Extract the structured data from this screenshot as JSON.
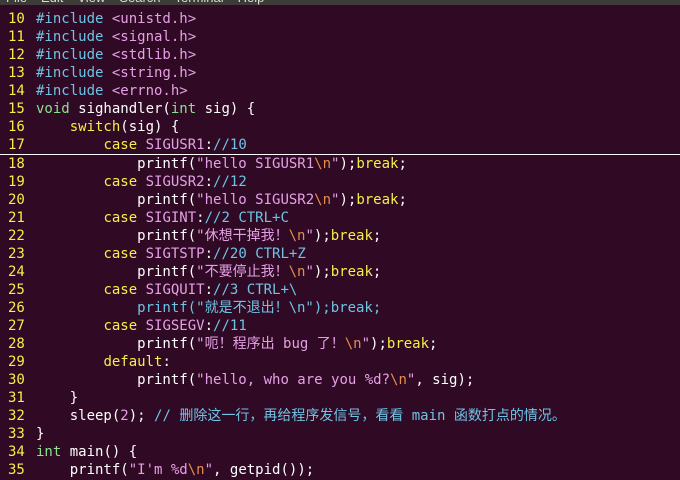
{
  "menu": [
    "File",
    "Edit",
    "View",
    "Search",
    "Terminal",
    "Help"
  ],
  "lines": [
    {
      "n": "10",
      "segs": [
        [
          "pp",
          "#include "
        ],
        [
          "inc",
          "<unistd.h>"
        ]
      ]
    },
    {
      "n": "11",
      "segs": [
        [
          "pp",
          "#include "
        ],
        [
          "inc",
          "<signal.h>"
        ]
      ]
    },
    {
      "n": "12",
      "segs": [
        [
          "pp",
          "#include "
        ],
        [
          "inc",
          "<stdlib.h>"
        ]
      ]
    },
    {
      "n": "13",
      "segs": [
        [
          "pp",
          "#include "
        ],
        [
          "inc",
          "<string.h>"
        ]
      ]
    },
    {
      "n": "14",
      "segs": [
        [
          "pp",
          "#include "
        ],
        [
          "inc",
          "<errno.h>"
        ]
      ]
    },
    {
      "n": "15",
      "segs": [
        [
          "ty",
          "void"
        ],
        [
          "id",
          " sighandler("
        ],
        [
          "ty",
          "int"
        ],
        [
          "id",
          " sig) {"
        ]
      ]
    },
    {
      "n": "16",
      "segs": [
        [
          "id",
          "    "
        ],
        [
          "kw",
          "switch"
        ],
        [
          "id",
          "(sig) {"
        ]
      ]
    },
    {
      "n": "17",
      "cursor": true,
      "segs": [
        [
          "id",
          "        "
        ],
        [
          "kw",
          "case"
        ],
        [
          "id",
          " "
        ],
        [
          "cn",
          "SIGUSR1"
        ],
        [
          "id",
          ":"
        ],
        [
          "cm",
          "//10"
        ]
      ]
    },
    {
      "n": "18",
      "segs": [
        [
          "id",
          "            printf("
        ],
        [
          "str",
          "\"hello SIGUSR1"
        ],
        [
          "esc",
          "\\n"
        ],
        [
          "str",
          "\""
        ],
        [
          "id",
          ");"
        ],
        [
          "kw",
          "break"
        ],
        [
          "id",
          ";"
        ]
      ]
    },
    {
      "n": "19",
      "segs": [
        [
          "id",
          "        "
        ],
        [
          "kw",
          "case"
        ],
        [
          "id",
          " "
        ],
        [
          "cn",
          "SIGUSR2"
        ],
        [
          "id",
          ":"
        ],
        [
          "cm",
          "//12"
        ]
      ]
    },
    {
      "n": "20",
      "segs": [
        [
          "id",
          "            printf("
        ],
        [
          "str",
          "\"hello SIGUSR2"
        ],
        [
          "esc",
          "\\n"
        ],
        [
          "str",
          "\""
        ],
        [
          "id",
          ");"
        ],
        [
          "kw",
          "break"
        ],
        [
          "id",
          ";"
        ]
      ]
    },
    {
      "n": "21",
      "segs": [
        [
          "id",
          "        "
        ],
        [
          "kw",
          "case"
        ],
        [
          "id",
          " "
        ],
        [
          "cn",
          "SIGINT"
        ],
        [
          "id",
          ":"
        ],
        [
          "cm",
          "//2 CTRL+C"
        ]
      ]
    },
    {
      "n": "22",
      "segs": [
        [
          "id",
          "            printf("
        ],
        [
          "str",
          "\"休想干掉我！"
        ],
        [
          "esc",
          "\\n"
        ],
        [
          "str",
          "\""
        ],
        [
          "id",
          ");"
        ],
        [
          "kw",
          "break"
        ],
        [
          "id",
          ";"
        ]
      ]
    },
    {
      "n": "23",
      "segs": [
        [
          "id",
          "        "
        ],
        [
          "kw",
          "case"
        ],
        [
          "id",
          " "
        ],
        [
          "cn",
          "SIGTSTP"
        ],
        [
          "id",
          ":"
        ],
        [
          "cm",
          "//20 CTRL+Z"
        ]
      ]
    },
    {
      "n": "24",
      "segs": [
        [
          "id",
          "            printf("
        ],
        [
          "str",
          "\"不要停止我！"
        ],
        [
          "esc",
          "\\n"
        ],
        [
          "str",
          "\""
        ],
        [
          "id",
          ");"
        ],
        [
          "kw",
          "break"
        ],
        [
          "id",
          ";"
        ]
      ]
    },
    {
      "n": "25",
      "segs": [
        [
          "id",
          "        "
        ],
        [
          "kw",
          "case"
        ],
        [
          "id",
          " "
        ],
        [
          "cn",
          "SIGQUIT"
        ],
        [
          "id",
          ":"
        ],
        [
          "cm",
          "//3 CTRL+\\"
        ]
      ]
    },
    {
      "n": "26",
      "segs": [
        [
          "cm",
          "            printf(\"就是不退出！\\n\");break;"
        ]
      ]
    },
    {
      "n": "27",
      "segs": [
        [
          "id",
          "        "
        ],
        [
          "kw",
          "case"
        ],
        [
          "id",
          " "
        ],
        [
          "cn",
          "SIGSEGV"
        ],
        [
          "id",
          ":"
        ],
        [
          "cm",
          "//11"
        ]
      ]
    },
    {
      "n": "28",
      "segs": [
        [
          "id",
          "            printf("
        ],
        [
          "str",
          "\"呃！程序出 bug 了！"
        ],
        [
          "esc",
          "\\n"
        ],
        [
          "str",
          "\""
        ],
        [
          "id",
          ");"
        ],
        [
          "kw",
          "break"
        ],
        [
          "id",
          ";"
        ]
      ]
    },
    {
      "n": "29",
      "segs": [
        [
          "id",
          "        "
        ],
        [
          "kw",
          "default"
        ],
        [
          "id",
          ":"
        ]
      ]
    },
    {
      "n": "30",
      "segs": [
        [
          "id",
          "            printf("
        ],
        [
          "str",
          "\"hello, who are you %d?"
        ],
        [
          "esc",
          "\\n"
        ],
        [
          "str",
          "\""
        ],
        [
          "id",
          ", sig);"
        ]
      ]
    },
    {
      "n": "31",
      "segs": [
        [
          "id",
          "    }"
        ]
      ]
    },
    {
      "n": "32",
      "segs": [
        [
          "id",
          "    sleep("
        ],
        [
          "num",
          "2"
        ],
        [
          "id",
          "); "
        ],
        [
          "cm",
          "// 删除这一行，再给程序发信号，看看 main 函数打点的情况。"
        ]
      ]
    },
    {
      "n": "33",
      "segs": [
        [
          "id",
          "}"
        ]
      ]
    },
    {
      "n": "34",
      "segs": [
        [
          "ty",
          "int"
        ],
        [
          "id",
          " main() {"
        ]
      ]
    },
    {
      "n": "35",
      "segs": [
        [
          "id",
          "    printf("
        ],
        [
          "str",
          "\"I'm %d"
        ],
        [
          "esc",
          "\\n"
        ],
        [
          "str",
          "\""
        ],
        [
          "id",
          ", getpid());"
        ]
      ]
    }
  ]
}
